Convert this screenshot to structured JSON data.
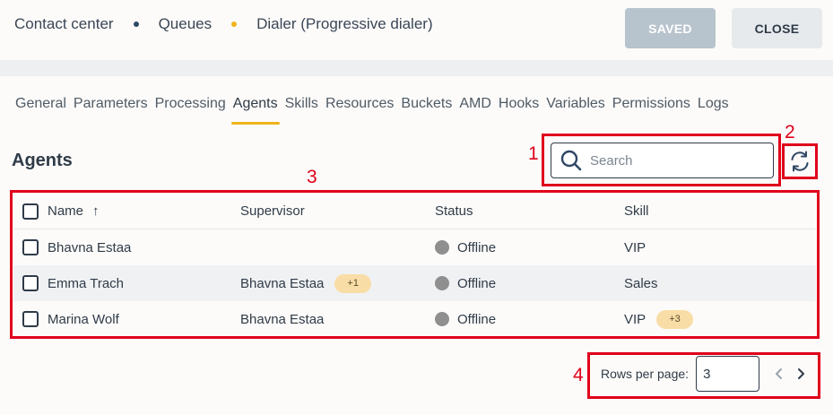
{
  "header": {
    "breadcrumbs": [
      "Contact center",
      "Queues",
      "Dialer (Progressive dialer)"
    ],
    "dot_colors": [
      "#2f4766",
      "#f0b31b"
    ],
    "saved_label": "SAVED",
    "close_label": "CLOSE"
  },
  "tabs": [
    "General",
    "Parameters",
    "Processing",
    "Agents",
    "Skills",
    "Resources",
    "Buckets",
    "AMD",
    "Hooks",
    "Variables",
    "Permissions",
    "Logs"
  ],
  "active_tab": "Agents",
  "section": {
    "title": "Agents"
  },
  "search": {
    "placeholder": "Search",
    "value": ""
  },
  "table": {
    "columns": [
      "Name",
      "Supervisor",
      "Status",
      "Skill"
    ],
    "sort_indicator": "↑",
    "rows": [
      {
        "name": "Bhavna Estaa",
        "supervisor": "",
        "supervisor_badge": "",
        "status": "Offline",
        "skill": "VIP",
        "skill_badge": ""
      },
      {
        "name": "Emma Trach",
        "supervisor": "Bhavna Estaa",
        "supervisor_badge": "+1",
        "status": "Offline",
        "skill": "Sales",
        "skill_badge": ""
      },
      {
        "name": "Marina Wolf",
        "supervisor": "Bhavna Estaa",
        "supervisor_badge": "",
        "status": "Offline",
        "skill": "VIP",
        "skill_badge": "+3"
      }
    ]
  },
  "pagination": {
    "rows_per_page_label": "Rows per page:",
    "rows_per_page_value": "3"
  },
  "annotations": [
    "1",
    "2",
    "3",
    "4"
  ],
  "colors": {
    "accent": "#f0b31b",
    "annotation": "#e0001b",
    "status_offline": "#8f8f8f",
    "badge": "#f9dda6"
  },
  "icons": {
    "search": "search-icon",
    "refresh": "refresh-icon",
    "prev": "chevron-left-icon",
    "next": "chevron-right-icon"
  }
}
